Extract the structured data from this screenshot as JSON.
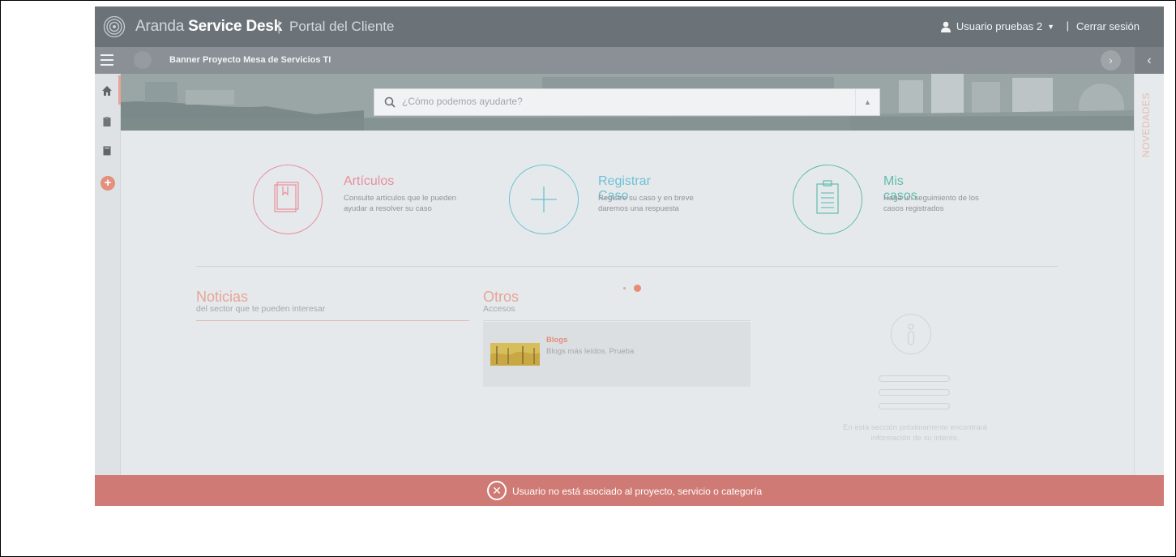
{
  "header": {
    "brand_light": "Aranda",
    "brand_bold": "Service Desk",
    "separator": "|",
    "portal": "Portal del Cliente",
    "user_name": "Usuario pruebas 2",
    "user_separator": "|",
    "logout": "Cerrar sesión"
  },
  "subbar": {
    "banner_title": "Banner Proyecto Mesa de Servicios TI"
  },
  "search": {
    "placeholder": "¿Cómo podemos ayudarte?"
  },
  "right_panel": {
    "label": "NOVEDADES"
  },
  "features": [
    {
      "title": "Artículos",
      "desc": "Consulte artículos que le pueden ayudar a resolver su caso",
      "color": "#e58f9c"
    },
    {
      "title": "Registrar Caso",
      "desc": "Registre su caso y en breve daremos una respuesta",
      "color": "#6cc2d4"
    },
    {
      "title": "Mis casos",
      "desc": "Haga un seguimiento de los casos registrados",
      "color": "#5fbcae"
    }
  ],
  "news": {
    "title": "Noticias",
    "subtitle": "del sector que te pueden interesar"
  },
  "others": {
    "title": "Otros",
    "subtitle": "Accesos",
    "blog": {
      "name": "Blogs",
      "desc": "Blogs más leídos. Prueba"
    }
  },
  "empty_state": {
    "text": "En esta sección próximamente encontrará información de su interés."
  },
  "error": {
    "message": "Usuario no está asociado al proyecto, servicio o categoría"
  }
}
